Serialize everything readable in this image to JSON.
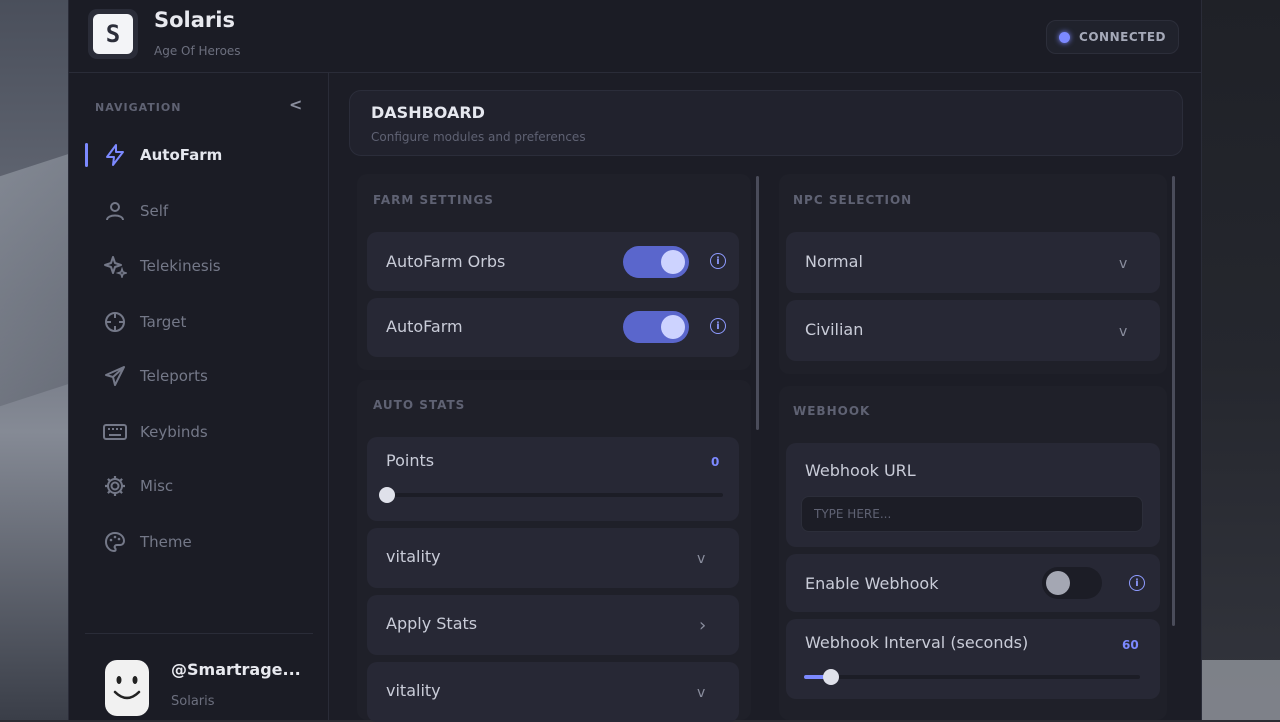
{
  "app": {
    "title": "Solaris",
    "subtitle": "Age Of Heroes",
    "logo_letter": "S"
  },
  "status": {
    "label": "CONNECTED",
    "color": "#7c89ff"
  },
  "sidebar": {
    "heading": "NAVIGATION",
    "collapse_icon": "<",
    "items": [
      {
        "label": "AutoFarm",
        "icon": "bolt-icon",
        "active": true
      },
      {
        "label": "Self",
        "icon": "user-icon"
      },
      {
        "label": "Telekinesis",
        "icon": "sparkle-icon"
      },
      {
        "label": "Target",
        "icon": "crosshair-icon"
      },
      {
        "label": "Teleports",
        "icon": "plane-icon"
      },
      {
        "label": "Keybinds",
        "icon": "keyboard-icon"
      },
      {
        "label": "Misc",
        "icon": "gear-icon"
      },
      {
        "label": "Theme",
        "icon": "palette-icon"
      }
    ],
    "user": {
      "name": "@Smartrage...",
      "sub": "Solaris"
    }
  },
  "dashboard": {
    "title": "DASHBOARD",
    "subtitle": "Configure modules and preferences"
  },
  "farm_settings": {
    "title": "FARM SETTINGS",
    "toggles": [
      {
        "label": "AutoFarm Orbs",
        "on": true
      },
      {
        "label": "AutoFarm",
        "on": true
      }
    ]
  },
  "auto_stats": {
    "title": "AUTO STATS",
    "points": {
      "label": "Points",
      "value": "0",
      "fraction": 0
    },
    "dropdown1": "vitality",
    "apply": "Apply Stats",
    "dropdown2": "vitality"
  },
  "npc_selection": {
    "title": "NPC SELECTION",
    "options": [
      "Normal",
      "Civilian"
    ]
  },
  "webhook": {
    "title": "WEBHOOK",
    "url_label": "Webhook URL",
    "url_placeholder": "TYPE HERE...",
    "enable_label": "Enable Webhook",
    "enable_on": false,
    "interval_label": "Webhook Interval (seconds)",
    "interval_value": "60",
    "interval_fraction": 0.08
  },
  "chevron_down": "v",
  "chevron_right": "›",
  "info_glyph": "i"
}
